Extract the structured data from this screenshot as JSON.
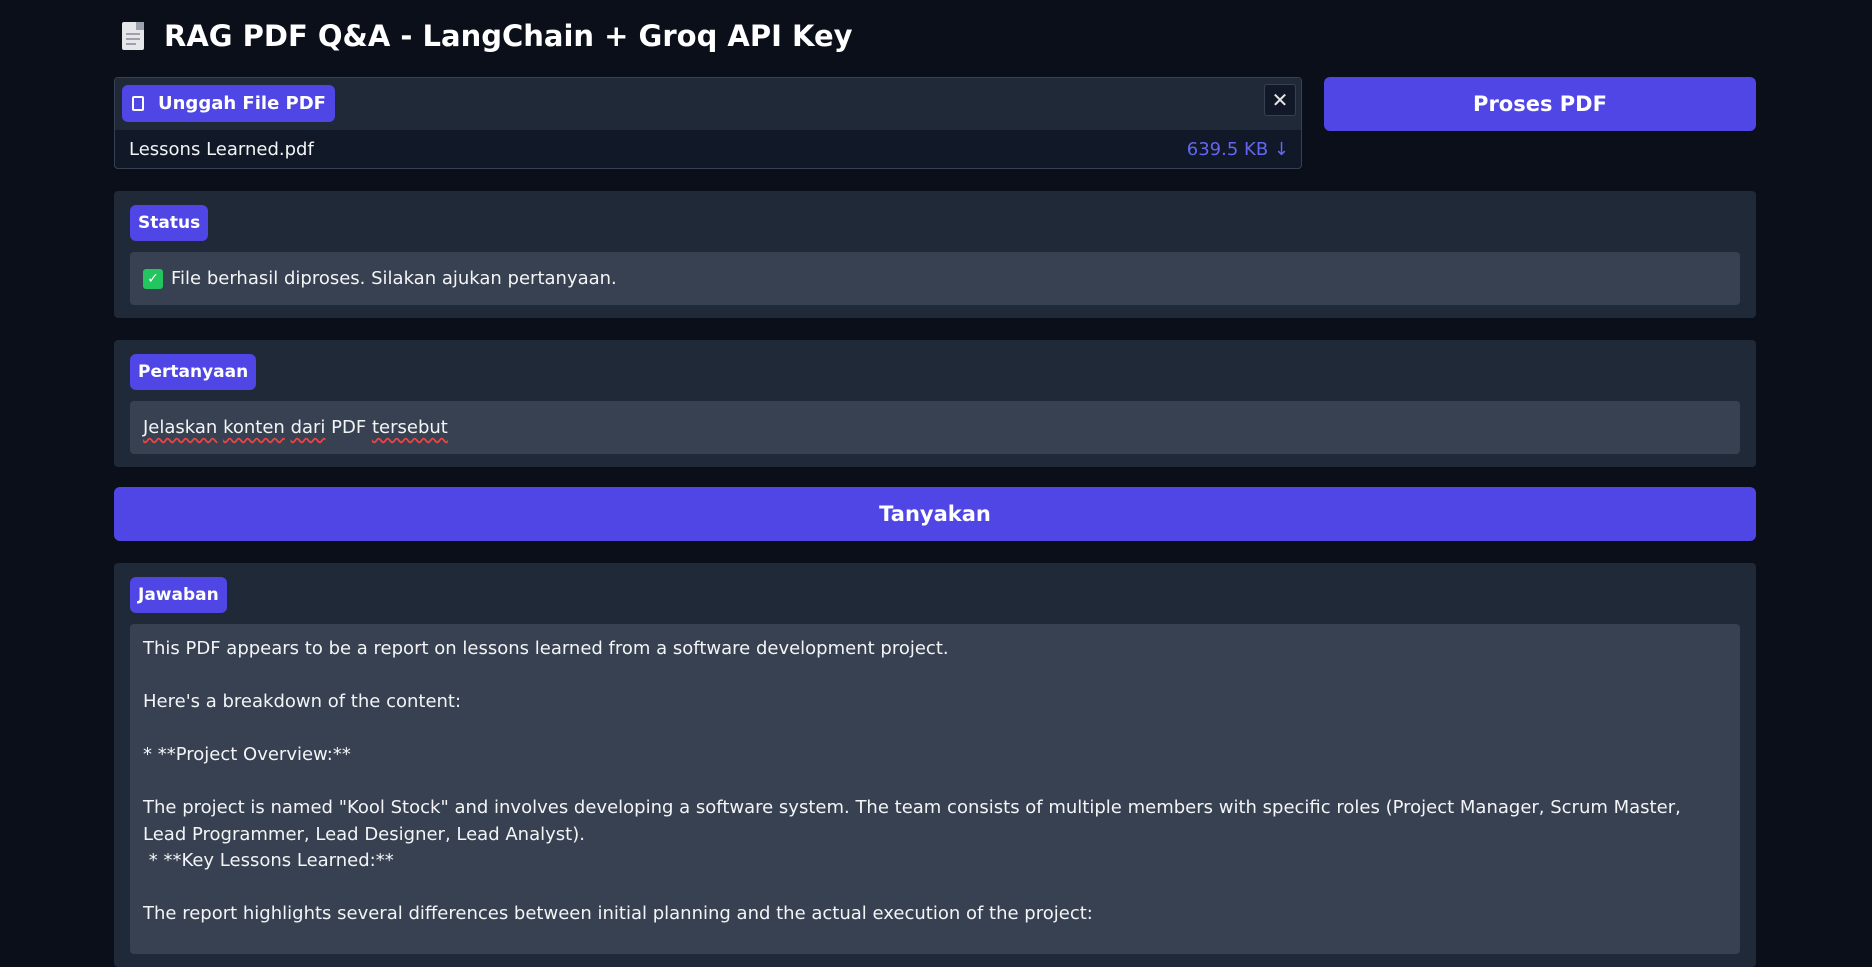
{
  "title": "RAG PDF Q&A - LangChain + Groq API Key",
  "upload": {
    "label": "Unggah File PDF",
    "file_name": "Lessons Learned.pdf",
    "file_size": "639.5 KB ↓",
    "close_symbol": "✕"
  },
  "process_button": "Proses PDF",
  "status": {
    "label": "Status",
    "check_symbol": "✓",
    "text": "File berhasil diproses. Silakan ajukan pertanyaan."
  },
  "question": {
    "label": "Pertanyaan",
    "words": [
      "Jelaskan",
      "konten",
      "dari",
      "PDF",
      "tersebut"
    ]
  },
  "ask_button": "Tanyakan",
  "answer": {
    "label": "Jawaban",
    "lines": [
      "This PDF appears to be a report on lessons learned from a software development project.",
      "",
      "Here's a breakdown of the content:",
      "",
      "* **Project Overview:**",
      "",
      "The project is named \"Kool Stock\" and involves developing a software system. The team consists of multiple members with specific roles (Project Manager, Scrum Master, Lead Programmer, Lead Designer, Lead Analyst).",
      " * **Key Lessons Learned:**",
      "",
      "The report highlights several differences between initial planning and the actual execution of the project:"
    ]
  },
  "colors": {
    "background": "#0b0f19",
    "panel": "#1f2937",
    "field": "#374151",
    "accent": "#4f46e5",
    "file_size": "#6366f1",
    "check": "#22c55e"
  }
}
